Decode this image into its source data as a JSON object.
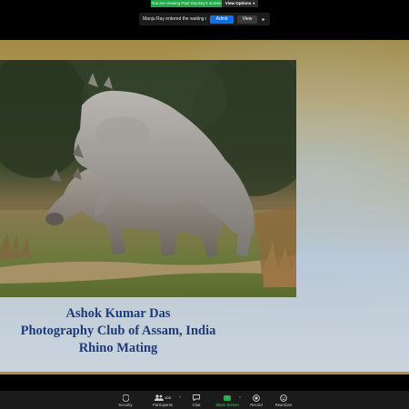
{
  "banner": {
    "viewing_text": "You are viewing Paul Stuckey's screen",
    "view_options_label": "View Options",
    "view_options_chevron": "▾"
  },
  "notification": {
    "message": "Manju Ray entered the waiting room",
    "admit_label": "Admit",
    "view_label": "View",
    "more_glyph": "▸"
  },
  "slide": {
    "photo_alt": "",
    "caption_lines": [
      "Ashok Kumar Das",
      "Photography Club of Assam, India",
      "Rhino Mating"
    ]
  },
  "toolbar": {
    "items": [
      {
        "label": "Security",
        "icon": "shield-icon"
      },
      {
        "label": "Participants",
        "icon": "participants-icon",
        "count": "103"
      },
      {
        "label": "Chat",
        "icon": "chat-icon"
      },
      {
        "label": "Share Screen",
        "icon": "share-screen-icon"
      },
      {
        "label": "Record",
        "icon": "record-icon"
      },
      {
        "label": "Reactions",
        "icon": "reactions-icon"
      }
    ],
    "caret_glyph": "˄"
  },
  "colors": {
    "banner_green": "#22a84a",
    "admit_blue": "#0e71eb",
    "caption_blue": "#1e3a7b",
    "share_green": "#22a84a"
  }
}
